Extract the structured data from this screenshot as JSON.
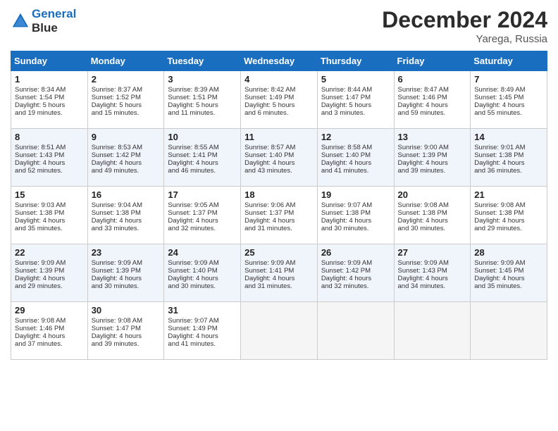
{
  "header": {
    "logo_line1": "General",
    "logo_line2": "Blue",
    "month": "December 2024",
    "location": "Yarega, Russia"
  },
  "days_of_week": [
    "Sunday",
    "Monday",
    "Tuesday",
    "Wednesday",
    "Thursday",
    "Friday",
    "Saturday"
  ],
  "weeks": [
    [
      {
        "day": "1",
        "lines": [
          "Sunrise: 8:34 AM",
          "Sunset: 1:54 PM",
          "Daylight: 5 hours",
          "and 19 minutes."
        ]
      },
      {
        "day": "2",
        "lines": [
          "Sunrise: 8:37 AM",
          "Sunset: 1:52 PM",
          "Daylight: 5 hours",
          "and 15 minutes."
        ]
      },
      {
        "day": "3",
        "lines": [
          "Sunrise: 8:39 AM",
          "Sunset: 1:51 PM",
          "Daylight: 5 hours",
          "and 11 minutes."
        ]
      },
      {
        "day": "4",
        "lines": [
          "Sunrise: 8:42 AM",
          "Sunset: 1:49 PM",
          "Daylight: 5 hours",
          "and 6 minutes."
        ]
      },
      {
        "day": "5",
        "lines": [
          "Sunrise: 8:44 AM",
          "Sunset: 1:47 PM",
          "Daylight: 5 hours",
          "and 3 minutes."
        ]
      },
      {
        "day": "6",
        "lines": [
          "Sunrise: 8:47 AM",
          "Sunset: 1:46 PM",
          "Daylight: 4 hours",
          "and 59 minutes."
        ]
      },
      {
        "day": "7",
        "lines": [
          "Sunrise: 8:49 AM",
          "Sunset: 1:45 PM",
          "Daylight: 4 hours",
          "and 55 minutes."
        ]
      }
    ],
    [
      {
        "day": "8",
        "lines": [
          "Sunrise: 8:51 AM",
          "Sunset: 1:43 PM",
          "Daylight: 4 hours",
          "and 52 minutes."
        ]
      },
      {
        "day": "9",
        "lines": [
          "Sunrise: 8:53 AM",
          "Sunset: 1:42 PM",
          "Daylight: 4 hours",
          "and 49 minutes."
        ]
      },
      {
        "day": "10",
        "lines": [
          "Sunrise: 8:55 AM",
          "Sunset: 1:41 PM",
          "Daylight: 4 hours",
          "and 46 minutes."
        ]
      },
      {
        "day": "11",
        "lines": [
          "Sunrise: 8:57 AM",
          "Sunset: 1:40 PM",
          "Daylight: 4 hours",
          "and 43 minutes."
        ]
      },
      {
        "day": "12",
        "lines": [
          "Sunrise: 8:58 AM",
          "Sunset: 1:40 PM",
          "Daylight: 4 hours",
          "and 41 minutes."
        ]
      },
      {
        "day": "13",
        "lines": [
          "Sunrise: 9:00 AM",
          "Sunset: 1:39 PM",
          "Daylight: 4 hours",
          "and 39 minutes."
        ]
      },
      {
        "day": "14",
        "lines": [
          "Sunrise: 9:01 AM",
          "Sunset: 1:38 PM",
          "Daylight: 4 hours",
          "and 36 minutes."
        ]
      }
    ],
    [
      {
        "day": "15",
        "lines": [
          "Sunrise: 9:03 AM",
          "Sunset: 1:38 PM",
          "Daylight: 4 hours",
          "and 35 minutes."
        ]
      },
      {
        "day": "16",
        "lines": [
          "Sunrise: 9:04 AM",
          "Sunset: 1:38 PM",
          "Daylight: 4 hours",
          "and 33 minutes."
        ]
      },
      {
        "day": "17",
        "lines": [
          "Sunrise: 9:05 AM",
          "Sunset: 1:37 PM",
          "Daylight: 4 hours",
          "and 32 minutes."
        ]
      },
      {
        "day": "18",
        "lines": [
          "Sunrise: 9:06 AM",
          "Sunset: 1:37 PM",
          "Daylight: 4 hours",
          "and 31 minutes."
        ]
      },
      {
        "day": "19",
        "lines": [
          "Sunrise: 9:07 AM",
          "Sunset: 1:38 PM",
          "Daylight: 4 hours",
          "and 30 minutes."
        ]
      },
      {
        "day": "20",
        "lines": [
          "Sunrise: 9:08 AM",
          "Sunset: 1:38 PM",
          "Daylight: 4 hours",
          "and 30 minutes."
        ]
      },
      {
        "day": "21",
        "lines": [
          "Sunrise: 9:08 AM",
          "Sunset: 1:38 PM",
          "Daylight: 4 hours",
          "and 29 minutes."
        ]
      }
    ],
    [
      {
        "day": "22",
        "lines": [
          "Sunrise: 9:09 AM",
          "Sunset: 1:39 PM",
          "Daylight: 4 hours",
          "and 29 minutes."
        ]
      },
      {
        "day": "23",
        "lines": [
          "Sunrise: 9:09 AM",
          "Sunset: 1:39 PM",
          "Daylight: 4 hours",
          "and 30 minutes."
        ]
      },
      {
        "day": "24",
        "lines": [
          "Sunrise: 9:09 AM",
          "Sunset: 1:40 PM",
          "Daylight: 4 hours",
          "and 30 minutes."
        ]
      },
      {
        "day": "25",
        "lines": [
          "Sunrise: 9:09 AM",
          "Sunset: 1:41 PM",
          "Daylight: 4 hours",
          "and 31 minutes."
        ]
      },
      {
        "day": "26",
        "lines": [
          "Sunrise: 9:09 AM",
          "Sunset: 1:42 PM",
          "Daylight: 4 hours",
          "and 32 minutes."
        ]
      },
      {
        "day": "27",
        "lines": [
          "Sunrise: 9:09 AM",
          "Sunset: 1:43 PM",
          "Daylight: 4 hours",
          "and 34 minutes."
        ]
      },
      {
        "day": "28",
        "lines": [
          "Sunrise: 9:09 AM",
          "Sunset: 1:45 PM",
          "Daylight: 4 hours",
          "and 35 minutes."
        ]
      }
    ],
    [
      {
        "day": "29",
        "lines": [
          "Sunrise: 9:08 AM",
          "Sunset: 1:46 PM",
          "Daylight: 4 hours",
          "and 37 minutes."
        ]
      },
      {
        "day": "30",
        "lines": [
          "Sunrise: 9:08 AM",
          "Sunset: 1:47 PM",
          "Daylight: 4 hours",
          "and 39 minutes."
        ]
      },
      {
        "day": "31",
        "lines": [
          "Sunrise: 9:07 AM",
          "Sunset: 1:49 PM",
          "Daylight: 4 hours",
          "and 41 minutes."
        ]
      },
      null,
      null,
      null,
      null
    ]
  ]
}
